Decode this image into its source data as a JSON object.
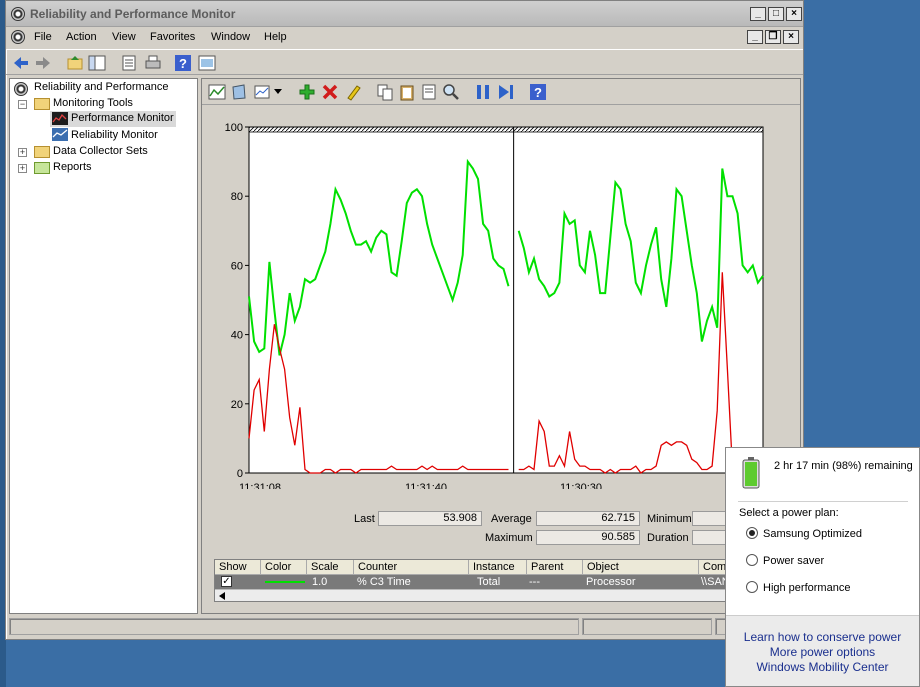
{
  "window": {
    "title": "Reliability and Performance Monitor"
  },
  "menu": [
    "File",
    "Action",
    "View",
    "Favorites",
    "Window",
    "Help"
  ],
  "tree": {
    "root": "Reliability and Performance",
    "items": [
      {
        "label": "Monitoring Tools",
        "children": [
          "Performance Monitor",
          "Reliability Monitor"
        ]
      },
      {
        "label": "Data Collector Sets"
      },
      {
        "label": "Reports"
      }
    ]
  },
  "chart_data": {
    "type": "line",
    "ylim": [
      0,
      100
    ],
    "y_ticks": [
      "100",
      "80",
      "60",
      "40",
      "20",
      "0"
    ],
    "x_ticks": [
      "11:31:08",
      "11:31:40",
      "11:30:30"
    ],
    "grid": false,
    "series": [
      {
        "color": "#00e000",
        "values": [
          51,
          38,
          35,
          36,
          61,
          47,
          34,
          40,
          52,
          44,
          48,
          56,
          55,
          56,
          60,
          64,
          72,
          82,
          79,
          75,
          70,
          66,
          66,
          67,
          64,
          68,
          70,
          69,
          58,
          57,
          67,
          78,
          81,
          82,
          80,
          72,
          66,
          62,
          58,
          54,
          50,
          55,
          63,
          90,
          88,
          85,
          72,
          70,
          62,
          60,
          59,
          54,
          null,
          70,
          65,
          58,
          62,
          56,
          54,
          51,
          52,
          55,
          75,
          72,
          73,
          60,
          58,
          70,
          63,
          52,
          52,
          68,
          84,
          82,
          72,
          67,
          55,
          52,
          60,
          66,
          71,
          56,
          48,
          62,
          82,
          80,
          70,
          60,
          52,
          38,
          44,
          48,
          42,
          88,
          80,
          80,
          75,
          60,
          58,
          60,
          55,
          57
        ]
      },
      {
        "color": "#e00000",
        "values": [
          10,
          24,
          27,
          12,
          30,
          43,
          36,
          30,
          16,
          8,
          19,
          1,
          0,
          0,
          0,
          1,
          1,
          0,
          1,
          1,
          1,
          0,
          1,
          1,
          1,
          1,
          1,
          1,
          2,
          1,
          1,
          1,
          1,
          1,
          2,
          1,
          2,
          1,
          1,
          1,
          1,
          1,
          2,
          1,
          1,
          1,
          1,
          1,
          1,
          1,
          1,
          1,
          null,
          1,
          1,
          2,
          1,
          15,
          12,
          2,
          2,
          5,
          2,
          12,
          4,
          2,
          2,
          1,
          1,
          1,
          0,
          1,
          0,
          1,
          1,
          1,
          2,
          0,
          1,
          1,
          2,
          8,
          9,
          8,
          9,
          9,
          8,
          4,
          3,
          1,
          1,
          2,
          18,
          58,
          30,
          1,
          1,
          1,
          1,
          1,
          1,
          1
        ]
      }
    ]
  },
  "stats": {
    "last_label": "Last",
    "last_value": "53.908",
    "average_label": "Average",
    "average_value": "62.715",
    "minimum_label": "Minimum",
    "maximum_label": "Maximum",
    "maximum_value": "90.585",
    "duration_label": "Duration"
  },
  "counter_table": {
    "headers": [
      "Show",
      "Color",
      "Scale",
      "Counter",
      "Instance",
      "Parent",
      "Object",
      "Comp"
    ],
    "row": {
      "scale": "1.0",
      "counter": "% C3 Time",
      "instance": "Total",
      "parent": "---",
      "object": "Processor",
      "computer": "\\\\SAN"
    }
  },
  "power_flyout": {
    "battery_text": "2 hr 17 min (98%) remaining",
    "plan_prompt": "Select a power plan:",
    "plans": [
      {
        "label": "Samsung Optimized",
        "selected": true
      },
      {
        "label": "Power saver",
        "selected": false
      },
      {
        "label": "High performance",
        "selected": false
      }
    ],
    "links": [
      "Learn how to conserve power",
      "More power options",
      "Windows Mobility Center"
    ]
  }
}
